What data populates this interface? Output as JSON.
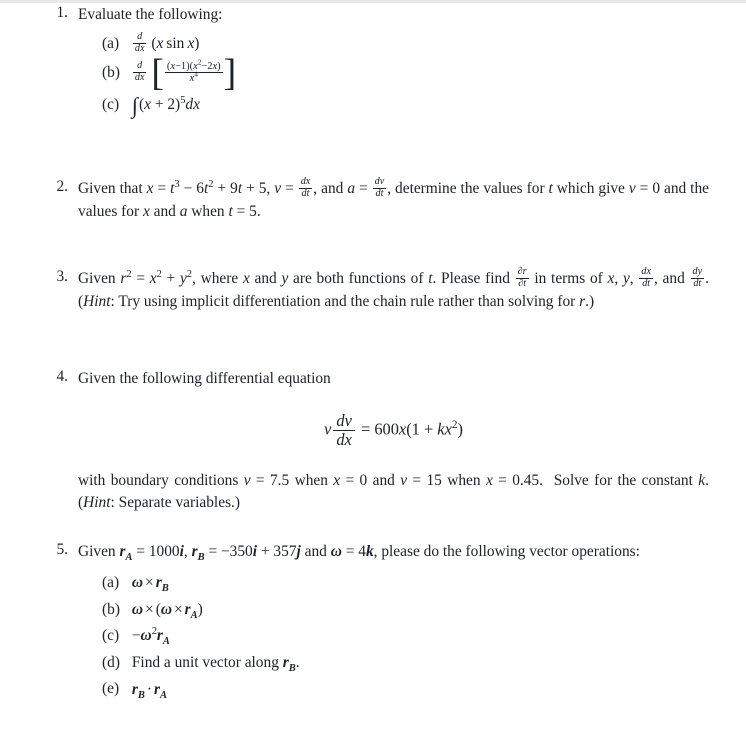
{
  "document": {
    "type": "math-homework-problem-set",
    "problems": [
      {
        "number": "1.",
        "stem": "Evaluate the following:",
        "parts": [
          {
            "label": "(a)",
            "expression": "d/dx (x sin x)"
          },
          {
            "label": "(b)",
            "expression": "d/dx [ (x-1)(x^2 - 2x) / x^4 ]"
          },
          {
            "label": "(c)",
            "expression": "∫(x + 2)^5 dx"
          }
        ]
      },
      {
        "number": "2.",
        "text_line1": "Given that x = t³ − 6t² + 9t + 5, v = dx/dt, and a = dv/dt, determine the values for t which give",
        "text_line2": "v = 0 and the values for x and a when t = 5.",
        "frag": {
          "given": "Given that",
          "x_expr_lead": "x",
          "eq": "=",
          "t3": "t",
          "minus": "−",
          "six": "6",
          "nine_t": "9t",
          "plus5": "+ 5,",
          "v": "v",
          "and_a": ", and",
          "a": "a",
          "tail": ", determine the values for",
          "t_var": "t",
          "which_give": "which give",
          "v_zero": "v = 0 and the values for",
          "x_var": "x",
          "and": "and",
          "a_var": "a",
          "when": "when",
          "t_eq5": "t = 5."
        }
      },
      {
        "number": "3.",
        "frag": {
          "given": "Given",
          "r2": "r",
          "eq": "=",
          "x2": "x",
          "plus": "+",
          "y2": "y",
          "where": ", where",
          "x_var": "x",
          "and1": "and",
          "y_var": "y",
          "are_funcs": "are both functions of",
          "t_var": "t",
          "please_find": ". Please find",
          "in_terms": "in terms of",
          "x_c": "x,",
          "y_c": "y,",
          "and2": "and",
          "hint_open": ". (",
          "hint_word": "Hint",
          "hint_text": ": Try using implicit differentiation and the chain rule rather than solving for",
          "r_var": "r",
          "close": ".)"
        }
      },
      {
        "number": "4.",
        "stem": "Given the following differential equation",
        "equation": "v dv/dx = 600x(1 + kx²)",
        "frag": {
          "v": "v",
          "eq": "=",
          "rhs_600x": "600x(1 +",
          "k": "k",
          "x2": "x",
          "close": ")",
          "bc_lead": "with boundary conditions",
          "v1": "v",
          "v1val": "= 7.5 when",
          "x1": "x",
          "x1val": "= 0 and",
          "v2": "v",
          "v2val": "= 15 when",
          "x2v": "x",
          "x2val": "= 0.45.  Solve for the",
          "const_lead": "constant",
          "k_var": "k",
          "hint_open": ". (",
          "hint_word": "Hint",
          "hint_text": ": Separate variables.)"
        }
      },
      {
        "number": "5.",
        "frag": {
          "given": "Given",
          "rA": "r",
          "subA": "A",
          "eq1": "= 1000",
          "i1": "i",
          "comma": ",",
          "rB": "r",
          "subB": "B",
          "eq2": "= −350",
          "i2": "i",
          "plus": "+ 357",
          "j1": "j",
          "and": "and",
          "omega": "ω",
          "eq3": "= 4",
          "k1": "k",
          "tail": ", please do the following vector operations:"
        },
        "parts": [
          {
            "label": "(a)",
            "expression": "ω × rB"
          },
          {
            "label": "(b)",
            "expression": "ω × (ω × rA)"
          },
          {
            "label": "(c)",
            "expression": "−ω²rA"
          },
          {
            "label": "(d)",
            "expression": "Find a unit vector along rB."
          },
          {
            "label": "(e)",
            "expression": "rB · rA"
          }
        ],
        "part_d_text": "Find a unit vector along"
      }
    ]
  },
  "colors": {
    "text": "#20232e",
    "background": "#ffffff",
    "top_band": "#e8e8e8"
  }
}
